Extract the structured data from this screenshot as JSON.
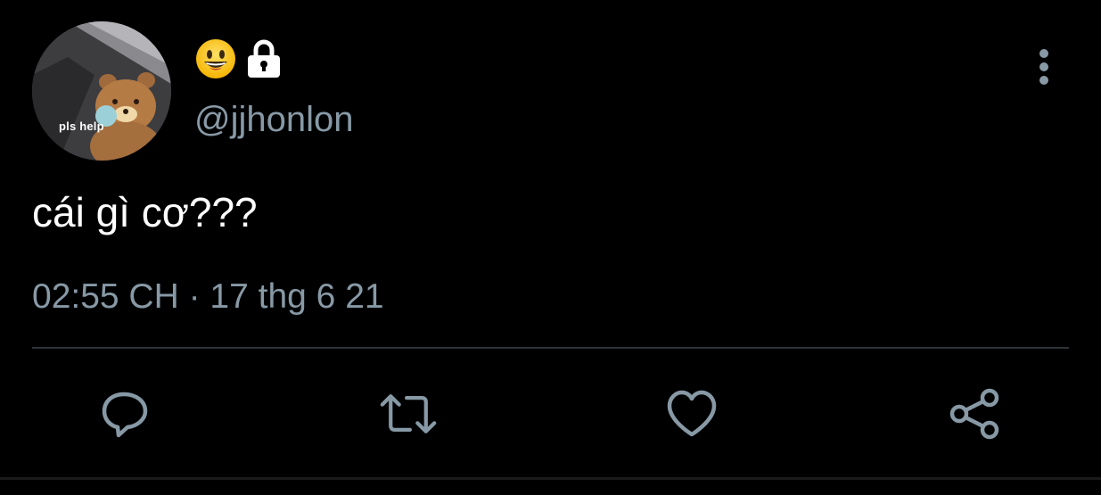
{
  "tweet": {
    "avatar": {
      "caption": "pls help"
    },
    "display_name": {
      "emoji_icon": "grinning-face-emoji",
      "lock_icon": "lock-icon"
    },
    "handle": "@jjhonlon",
    "text": "cái gì cơ???",
    "meta": "02:55 CH · 17 thg 6 21"
  },
  "actions": [
    {
      "name": "reply",
      "icon": "reply-icon"
    },
    {
      "name": "retweet",
      "icon": "retweet-icon"
    },
    {
      "name": "like",
      "icon": "heart-icon"
    },
    {
      "name": "share",
      "icon": "share-icon"
    }
  ],
  "colors": {
    "background": "#000000",
    "primary_text": "#ffffff",
    "secondary_text": "#8899a6",
    "divider": "#2f3336",
    "icon": "#8899a6"
  }
}
